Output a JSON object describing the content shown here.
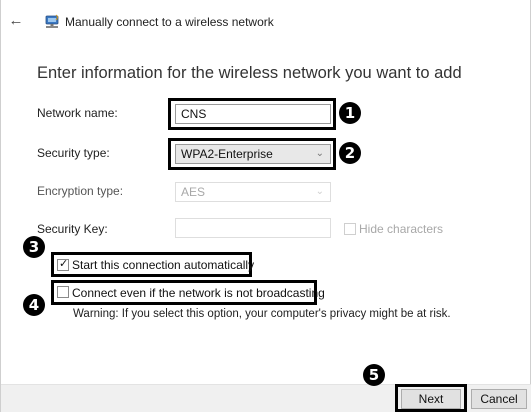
{
  "window": {
    "title": "Manually connect to a wireless network",
    "back_glyph": "←",
    "icon": "network-icon"
  },
  "heading": "Enter information for the wireless network you want to add",
  "form": {
    "network_name": {
      "label": "Network name:",
      "value": "CNS"
    },
    "security_type": {
      "label": "Security type:",
      "value": "WPA2-Enterprise"
    },
    "encryption_type": {
      "label": "Encryption type:",
      "value": "AES"
    },
    "security_key": {
      "label": "Security Key:",
      "value": ""
    },
    "hide_characters": {
      "label": "Hide characters",
      "checked": false
    },
    "start_automatically": {
      "label": "Start this connection automatically",
      "checked": true
    },
    "connect_not_broadcasting": {
      "label": "Connect even if the network is not broadcasting",
      "checked": false
    },
    "warning": "Warning: If you select this option, your computer's privacy might be at risk."
  },
  "annotations": [
    "1",
    "2",
    "3",
    "4",
    "5"
  ],
  "buttons": {
    "next": "Next",
    "cancel": "Cancel"
  },
  "glyphs": {
    "chevron": "⌄",
    "check": "✓"
  }
}
